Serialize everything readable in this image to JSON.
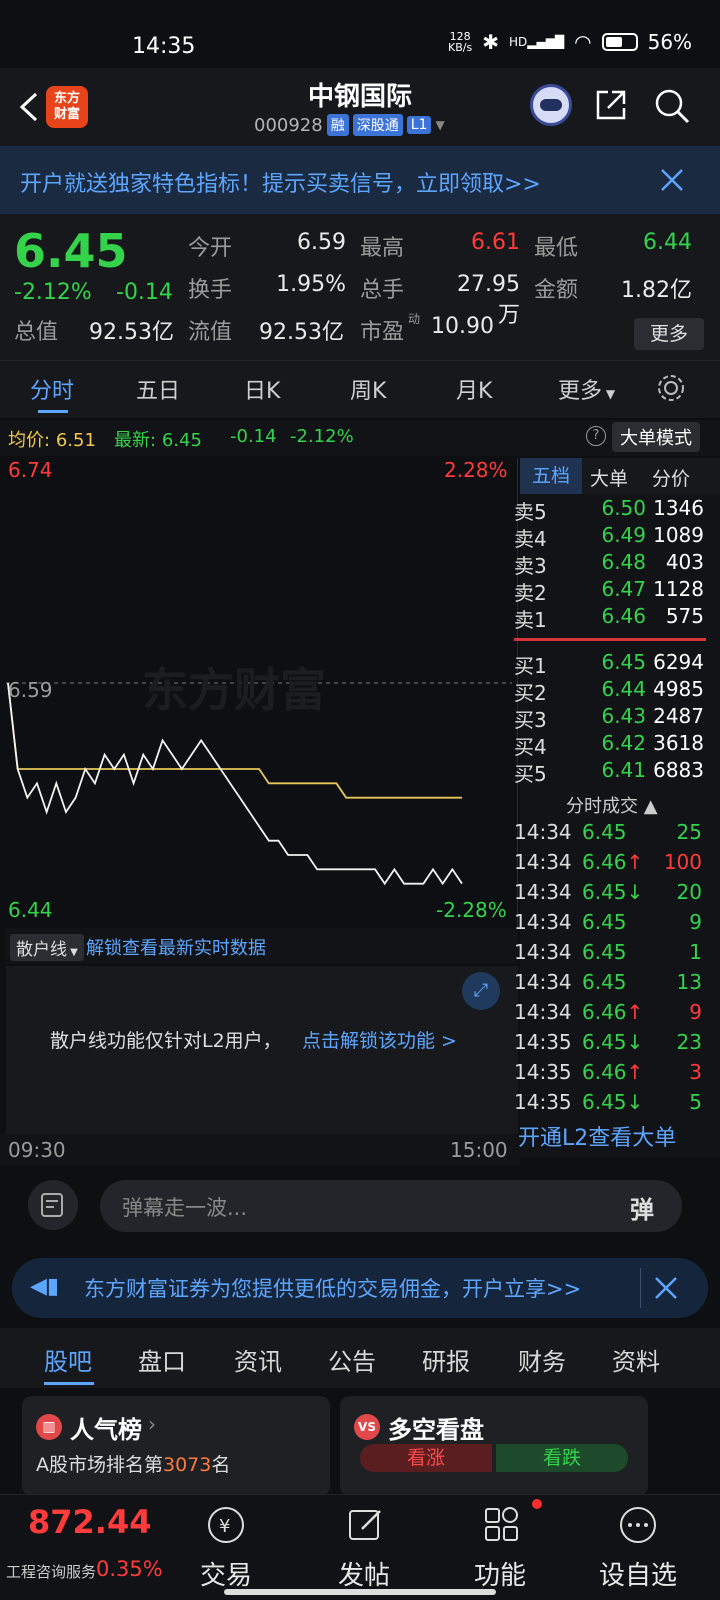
{
  "status": {
    "time": "14:35",
    "speed_top": "128",
    "speed_bottom": "KB/s",
    "signal": "HD",
    "battery": "56%"
  },
  "header": {
    "logo_top": "东方",
    "logo_bottom": "财富",
    "title": "中钢国际",
    "code": "000928",
    "tags": [
      "融",
      "深股通",
      "L1"
    ]
  },
  "banner": {
    "text": "开户就送独家特色指标！提示买卖信号，立即领取>>"
  },
  "quote": {
    "price": "6.45",
    "change_pct": "-2.12%",
    "change": "-0.14",
    "fields": [
      {
        "label": "今开",
        "value": "6.59",
        "color": "w"
      },
      {
        "label": "最高",
        "value": "6.61",
        "color": "r"
      },
      {
        "label": "最低",
        "value": "6.44",
        "color": "g"
      },
      {
        "label": "换手",
        "value": "1.95%",
        "color": "w"
      },
      {
        "label": "总手",
        "value": "27.95万",
        "color": "w"
      },
      {
        "label": "金额",
        "value": "1.82亿",
        "color": "w"
      },
      {
        "label": "总值",
        "value": "92.53亿",
        "color": "w"
      },
      {
        "label": "流值",
        "value": "92.53亿",
        "color": "w"
      },
      {
        "label": "市盈",
        "value": "10.90",
        "color": "w"
      }
    ],
    "pe_sup": "动",
    "more": "更多"
  },
  "tabs": [
    "分时",
    "五日",
    "日K",
    "周K",
    "月K",
    "更多"
  ],
  "avgbar": {
    "avg_label": "均价:",
    "avg": "6.51",
    "latest_label": "最新:",
    "latest": "6.45",
    "chg": "-0.14",
    "pct": "-2.12%",
    "mode": "大单模式"
  },
  "chart": {
    "y_top": "6.74",
    "y_top_pct": "2.28%",
    "y_mid": "6.59",
    "y_bottom": "6.44",
    "y_bottom_pct": "-2.28%",
    "watermark": "东方财富",
    "x_start": "09:30",
    "x_end": "15:00"
  },
  "chart_data": {
    "type": "line",
    "ylim": [
      6.44,
      6.74
    ],
    "base": 6.59,
    "price": [
      6.59,
      6.53,
      6.51,
      6.52,
      6.5,
      6.52,
      6.5,
      6.51,
      6.53,
      6.52,
      6.54,
      6.53,
      6.54,
      6.52,
      6.54,
      6.53,
      6.55,
      6.54,
      6.53,
      6.54,
      6.55,
      6.54,
      6.53,
      6.52,
      6.51,
      6.5,
      6.49,
      6.48,
      6.48,
      6.47,
      6.47,
      6.47,
      6.46,
      6.46,
      6.46,
      6.46,
      6.46,
      6.46,
      6.46,
      6.45,
      6.46,
      6.45,
      6.45,
      6.45,
      6.46,
      6.45,
      6.46,
      6.45
    ],
    "avg": [
      6.59,
      6.53,
      6.53,
      6.53,
      6.53,
      6.53,
      6.53,
      6.53,
      6.53,
      6.53,
      6.53,
      6.53,
      6.53,
      6.53,
      6.53,
      6.53,
      6.53,
      6.53,
      6.53,
      6.53,
      6.53,
      6.53,
      6.53,
      6.53,
      6.53,
      6.53,
      6.53,
      6.52,
      6.52,
      6.52,
      6.52,
      6.52,
      6.52,
      6.52,
      6.52,
      6.51,
      6.51,
      6.51,
      6.51,
      6.51,
      6.51,
      6.51,
      6.51,
      6.51,
      6.51,
      6.51,
      6.51,
      6.51
    ]
  },
  "orderbook": {
    "tabs": [
      "五档",
      "大单",
      "分价"
    ],
    "asks": [
      {
        "l": "卖5",
        "p": "6.50",
        "v": "1346"
      },
      {
        "l": "卖4",
        "p": "6.49",
        "v": "1089"
      },
      {
        "l": "卖3",
        "p": "6.48",
        "v": "403"
      },
      {
        "l": "卖2",
        "p": "6.47",
        "v": "1128"
      },
      {
        "l": "卖1",
        "p": "6.46",
        "v": "575"
      }
    ],
    "bids": [
      {
        "l": "买1",
        "p": "6.45",
        "v": "6294"
      },
      {
        "l": "买2",
        "p": "6.44",
        "v": "4985"
      },
      {
        "l": "买3",
        "p": "6.43",
        "v": "2487"
      },
      {
        "l": "买4",
        "p": "6.42",
        "v": "3618"
      },
      {
        "l": "买5",
        "p": "6.41",
        "v": "6883"
      }
    ],
    "trades_title": "分时成交",
    "trades": [
      {
        "t": "14:34",
        "p": "6.45",
        "v": "25",
        "c": "g"
      },
      {
        "t": "14:34",
        "p": "6.46↑",
        "v": "100",
        "c": "r"
      },
      {
        "t": "14:34",
        "p": "6.45↓",
        "v": "20",
        "c": "g"
      },
      {
        "t": "14:34",
        "p": "6.45",
        "v": "9",
        "c": "g"
      },
      {
        "t": "14:34",
        "p": "6.45",
        "v": "1",
        "c": "g"
      },
      {
        "t": "14:34",
        "p": "6.45",
        "v": "13",
        "c": "g"
      },
      {
        "t": "14:34",
        "p": "6.46↑",
        "v": "9",
        "c": "r"
      },
      {
        "t": "14:35",
        "p": "6.45↓",
        "v": "23",
        "c": "g"
      },
      {
        "t": "14:35",
        "p": "6.46↑",
        "v": "3",
        "c": "r"
      },
      {
        "t": "14:35",
        "p": "6.45↓",
        "v": "5",
        "c": "g"
      }
    ],
    "l2": "开通L2查看大单"
  },
  "sanhu": {
    "select": "散户线",
    "link": "解锁查看最新实时数据",
    "lock_text": "散户线功能仅针对L2用户，",
    "lock_link": "点击解锁该功能 >"
  },
  "danmu": {
    "placeholder": "弹幕走一波...",
    "btn": "弹"
  },
  "ad": {
    "text": "东方财富证券为您提供更低的交易佣金，开户立享>>"
  },
  "tabs2": [
    "股吧",
    "盘口",
    "资讯",
    "公告",
    "研报",
    "财务",
    "资料"
  ],
  "cards": {
    "left_title": "人气榜",
    "left_sub_pre": "A股市场排名第",
    "left_rank": "3073",
    "left_sub_post": "名",
    "right_title": "多空看盘",
    "up": "看涨",
    "down": "看跌"
  },
  "nav": {
    "index_value": "872.44",
    "index_name": "工程咨询服务",
    "index_pct": "0.35%",
    "items": [
      "交易",
      "发帖",
      "功能",
      "设自选"
    ]
  }
}
